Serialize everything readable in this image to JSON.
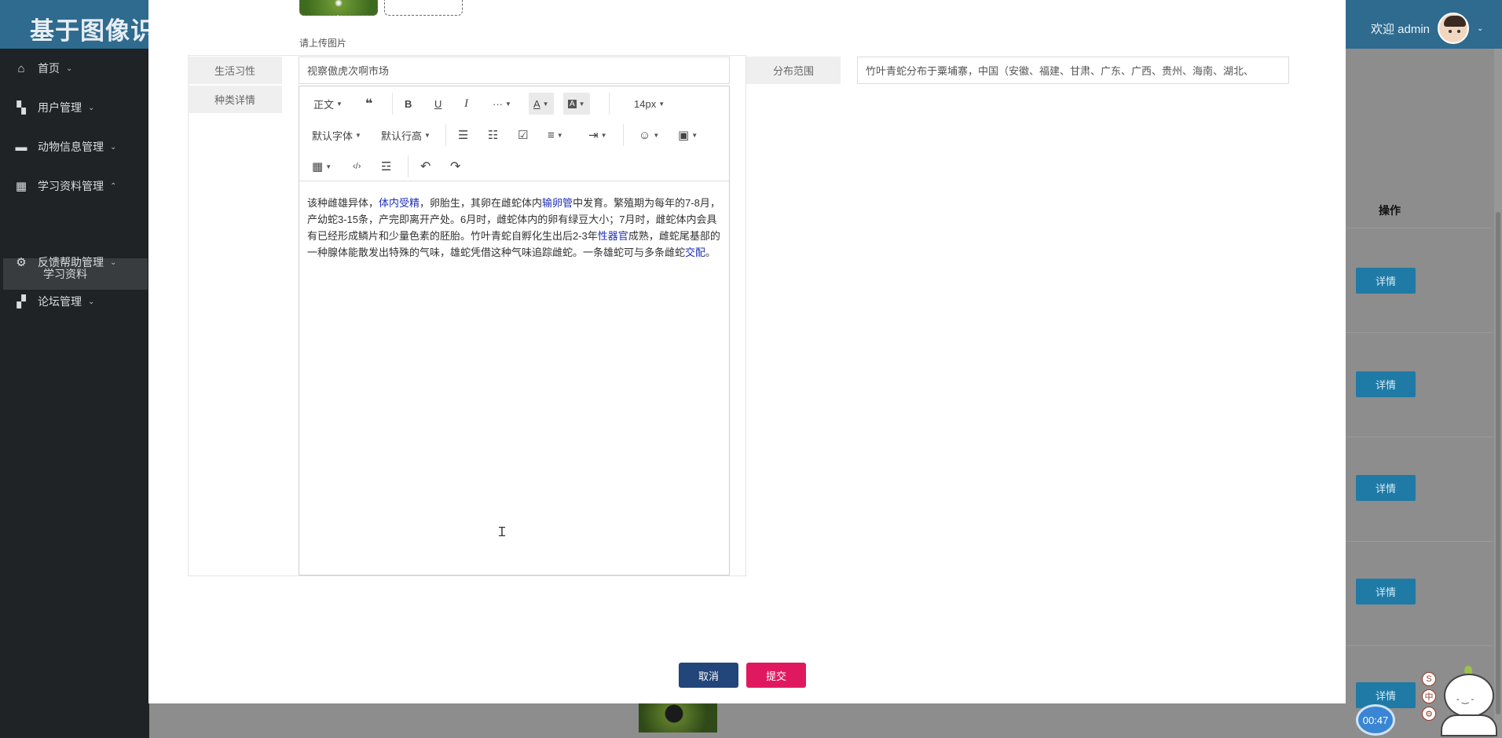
{
  "app": {
    "logo_text": "基于图像识",
    "welcome_text": "欢迎 admin"
  },
  "sidebar": {
    "items": [
      {
        "label": "首页",
        "icon": "home-icon"
      },
      {
        "label": "用户管理",
        "icon": "users-icon"
      },
      {
        "label": "动物信息管理",
        "icon": "list-icon"
      },
      {
        "label": "学习资料管理",
        "icon": "table-icon"
      },
      {
        "label": "反馈帮助管理",
        "icon": "gear-icon"
      },
      {
        "label": "论坛管理",
        "icon": "grid-icon"
      }
    ],
    "sub_item": "学习资料"
  },
  "table": {
    "op_header": "操作",
    "detail_label": "详情"
  },
  "modal": {
    "upload_hint": "请上传图片",
    "habit_label": "生活习性",
    "habit_value": "视察傲虎次啊市场",
    "range_label": "分布范围",
    "range_value": "竹叶青蛇分布于粟埔寨，中国（安徽、福建、甘肃、广东、广西、贵州、海南、湖北、",
    "detail_label": "种类详情",
    "toolbar": {
      "paragraph": "正文",
      "font_size": "14px",
      "font_family": "默认字体",
      "line_height": "默认行高"
    },
    "editor_text": {
      "p1": "该种雌雄异体，",
      "l1": "体内受精",
      "p2": "，卵胎生，其卵在雌蛇体内",
      "l2": "输卵管",
      "p3": "中发育。繁殖期为每年的7-8月，产幼蛇3-15条，产完即离开产处。6月时，雌蛇体内的卵有绿豆大小；7月时，雌蛇体内会具有已经形成鳞片和少量色素的胚胎。竹叶青蛇自孵化生出后2-3年",
      "l3": "性器官",
      "p4": "成熟，雌蛇尾基部的一种腺体能散发出特殊的气味，雄蛇凭借这种气味追踪雌蛇。一条雄蛇可与多条雌蛇",
      "l4": "交配",
      "p5": "。"
    },
    "cancel_label": "取消",
    "submit_label": "提交"
  },
  "widgets": {
    "timer": "00:47",
    "mini_tool_1": "S",
    "mini_tool_2": "中",
    "mascot_face": "- ‿ -"
  }
}
